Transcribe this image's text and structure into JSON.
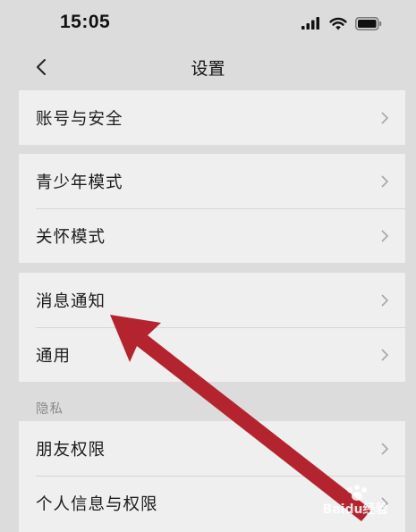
{
  "status_bar": {
    "time": "15:05"
  },
  "nav": {
    "title": "设置"
  },
  "groups": [
    {
      "items": [
        {
          "label": "账号与安全"
        }
      ]
    },
    {
      "items": [
        {
          "label": "青少年模式"
        },
        {
          "label": "关怀模式"
        }
      ]
    },
    {
      "items": [
        {
          "label": "消息通知"
        },
        {
          "label": "通用"
        }
      ]
    },
    {
      "header": "隐私",
      "items": [
        {
          "label": "朋友权限"
        },
        {
          "label": "个人信息与权限"
        }
      ]
    }
  ],
  "annotation": {
    "arrow_color": "#b4242f"
  },
  "watermark": {
    "text": "Baidu经验"
  }
}
